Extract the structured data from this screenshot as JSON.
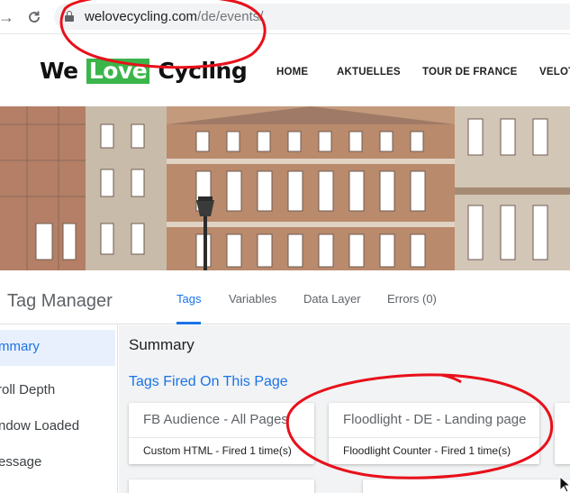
{
  "browser": {
    "back_icon": "arrow-right-icon",
    "reload_icon": "reload-icon",
    "url_host": "welovecycling.com",
    "url_path": "/de/events/"
  },
  "site": {
    "logo_we": "We",
    "logo_love": "Love",
    "logo_cycling": "Cycling",
    "menu": [
      "HOME",
      "AKTUELLES",
      "TOUR DE FRANCE",
      "VELOT"
    ]
  },
  "tag_manager": {
    "title": "Tag Manager",
    "tabs": [
      "Tags",
      "Variables",
      "Data Layer",
      "Errors (0)"
    ],
    "active_tab": "Tags",
    "sidebar": [
      "mmary",
      "roll Depth",
      "ndow Loaded",
      "essage"
    ],
    "summary_title": "Summary",
    "section_title": "Tags Fired On This Page",
    "cards": [
      {
        "title": "FB Audience - All Pages",
        "subtitle": "Custom HTML - Fired 1 time(s)"
      },
      {
        "title": "Floodlight - DE - Landing page",
        "subtitle": "Floodlight Counter - Fired 1 time(s)"
      }
    ]
  },
  "colors": {
    "accent": "#1a73e8",
    "logo_green": "#3bb54a",
    "annotation_red": "#e8101a"
  }
}
